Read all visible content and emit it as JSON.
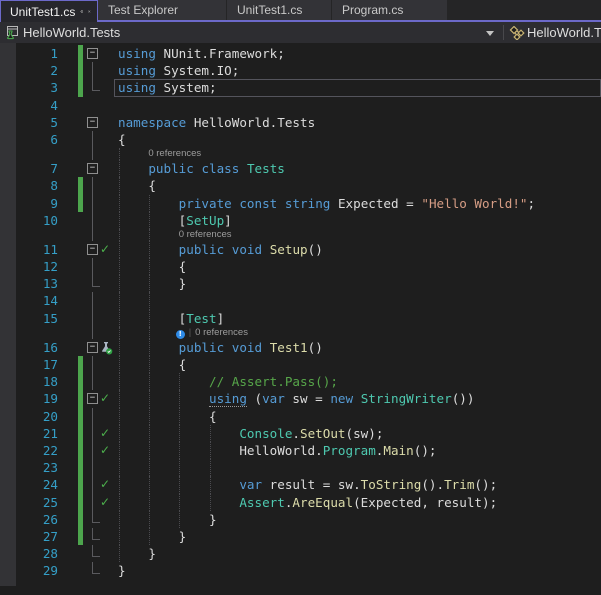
{
  "colors": {
    "accent": "#6C69C9",
    "editor_bg": "#1E1E1E",
    "tabwell_bg": "#252526",
    "tab_inactive_bg": "#333337",
    "navbar_bg": "#2D2D31",
    "margin_bg": "#333336",
    "keyword": "#569CD6",
    "type": "#4EC9B0",
    "method": "#DCDCAA",
    "string_lit": "#D69D85",
    "comment": "#57A64A",
    "plain": "#DCDCDC",
    "lineno": "#359FC7",
    "codelens": "#9D9D9D",
    "change_bar": "#4DA54D",
    "check": "#4CB04C",
    "guide": "#4B4B4F",
    "fold": "#5A5A5E",
    "current_line_border": "#54545C",
    "lens_info": "#2E8AE6"
  },
  "tabs": {
    "active": "UnitTest1.cs",
    "inactive": [
      "Test Explorer",
      "UnitTest1.cs",
      "Program.cs"
    ]
  },
  "navbar": {
    "project": "HelloWorld.Tests",
    "type_label": "HelloWorld.Tests"
  },
  "icons": {
    "fold_collapse": "−",
    "check": "✓",
    "lens_info_glyph": "!"
  },
  "editor": {
    "codelens_text": "0 references",
    "lines": [
      {
        "t": "c",
        "n": 1,
        "bar": 1,
        "fold": "box",
        "g": [],
        "tok": [
          [
            "k",
            "using"
          ],
          [
            "p",
            " NUnit.Framework;"
          ]
        ]
      },
      {
        "t": "c",
        "n": 2,
        "bar": 1,
        "fold": "line",
        "g": [],
        "tok": [
          [
            "k",
            "using"
          ],
          [
            "p",
            " System.IO;"
          ]
        ]
      },
      {
        "t": "c",
        "n": 3,
        "bar": 1,
        "cur": 1,
        "fold": "end",
        "g": [],
        "tok": [
          [
            "k",
            "using"
          ],
          [
            "p",
            " System;"
          ]
        ]
      },
      {
        "t": "c",
        "n": 4,
        "fold": "",
        "g": [],
        "tok": []
      },
      {
        "t": "c",
        "n": 5,
        "fold": "box",
        "g": [],
        "tok": [
          [
            "k",
            "namespace"
          ],
          [
            "p",
            " HelloWorld.Tests"
          ]
        ]
      },
      {
        "t": "c",
        "n": 6,
        "fold": "line",
        "g": [],
        "tok": [
          [
            "p",
            "{"
          ]
        ]
      },
      {
        "t": "l",
        "text": "0 references",
        "ind": 4,
        "fold": "line",
        "g": [
          0
        ]
      },
      {
        "t": "c",
        "n": 7,
        "fold": "box",
        "g": [
          0
        ],
        "tok": [
          [
            "p",
            "    "
          ],
          [
            "k",
            "public"
          ],
          [
            "p",
            " "
          ],
          [
            "k",
            "class"
          ],
          [
            "p",
            " "
          ],
          [
            "ty",
            "Tests"
          ]
        ]
      },
      {
        "t": "c",
        "n": 8,
        "bar": 1,
        "fold": "line",
        "g": [
          0
        ],
        "tok": [
          [
            "p",
            "    {"
          ]
        ]
      },
      {
        "t": "c",
        "n": 9,
        "bar": 1,
        "fold": "line",
        "g": [
          0,
          4
        ],
        "tok": [
          [
            "p",
            "        "
          ],
          [
            "k",
            "private"
          ],
          [
            "p",
            " "
          ],
          [
            "k",
            "const"
          ],
          [
            "p",
            " "
          ],
          [
            "k",
            "string"
          ],
          [
            "p",
            " Expected = "
          ],
          [
            "s",
            "\"Hello World!\""
          ],
          [
            "p",
            ";"
          ]
        ]
      },
      {
        "t": "c",
        "n": 10,
        "fold": "line",
        "g": [
          0,
          4
        ],
        "tok": [
          [
            "p",
            "        ["
          ],
          [
            "ty",
            "SetUp"
          ],
          [
            "p",
            "]"
          ]
        ]
      },
      {
        "t": "l",
        "text": "0 references",
        "ind": 8,
        "fold": "line",
        "g": [
          0,
          4
        ]
      },
      {
        "t": "c",
        "n": 11,
        "fold": "box",
        "glyph": "check",
        "g": [
          0,
          4
        ],
        "tok": [
          [
            "p",
            "        "
          ],
          [
            "k",
            "public"
          ],
          [
            "p",
            " "
          ],
          [
            "k",
            "void"
          ],
          [
            "p",
            " "
          ],
          [
            "m",
            "Setup"
          ],
          [
            "p",
            "()"
          ]
        ]
      },
      {
        "t": "c",
        "n": 12,
        "fold": "line",
        "g": [
          0,
          4
        ],
        "tok": [
          [
            "p",
            "        {"
          ]
        ]
      },
      {
        "t": "c",
        "n": 13,
        "fold": "end",
        "g": [
          0,
          4
        ],
        "tok": [
          [
            "p",
            "        }"
          ]
        ]
      },
      {
        "t": "c",
        "n": 14,
        "fold": "line",
        "g": [
          0,
          4
        ],
        "tok": []
      },
      {
        "t": "c",
        "n": 15,
        "fold": "line",
        "g": [
          0,
          4
        ],
        "tok": [
          [
            "p",
            "        ["
          ],
          [
            "ty",
            "Test"
          ],
          [
            "p",
            "]"
          ]
        ]
      },
      {
        "t": "l",
        "text": "0 references",
        "ind": 8,
        "fold": "line",
        "g": [
          0,
          4
        ],
        "info": 1
      },
      {
        "t": "c",
        "n": 16,
        "fold": "box",
        "glyph": "flask",
        "g": [
          0,
          4
        ],
        "tok": [
          [
            "p",
            "        "
          ],
          [
            "k",
            "public"
          ],
          [
            "p",
            " "
          ],
          [
            "k",
            "void"
          ],
          [
            "p",
            " "
          ],
          [
            "m",
            "Test1"
          ],
          [
            "p",
            "()"
          ]
        ]
      },
      {
        "t": "c",
        "n": 17,
        "bar": 1,
        "fold": "line",
        "g": [
          0,
          4
        ],
        "tok": [
          [
            "p",
            "        {"
          ]
        ]
      },
      {
        "t": "c",
        "n": 18,
        "bar": 1,
        "fold": "line",
        "g": [
          0,
          4,
          8
        ],
        "tok": [
          [
            "p",
            "            "
          ],
          [
            "c",
            "// Assert.Pass();"
          ]
        ]
      },
      {
        "t": "c",
        "n": 19,
        "bar": 1,
        "fold": "box",
        "glyph": "check",
        "g": [
          0,
          4,
          8
        ],
        "tok": [
          [
            "p",
            "            "
          ],
          [
            "ku",
            "using"
          ],
          [
            "p",
            " ("
          ],
          [
            "k",
            "var"
          ],
          [
            "p",
            " sw = "
          ],
          [
            "k",
            "new"
          ],
          [
            "p",
            " "
          ],
          [
            "ty",
            "StringWriter"
          ],
          [
            "p",
            "())"
          ]
        ]
      },
      {
        "t": "c",
        "n": 20,
        "bar": 1,
        "fold": "line",
        "g": [
          0,
          4,
          8
        ],
        "tok": [
          [
            "p",
            "            {"
          ]
        ]
      },
      {
        "t": "c",
        "n": 21,
        "bar": 1,
        "fold": "line",
        "glyph": "check",
        "g": [
          0,
          4,
          8,
          12
        ],
        "tok": [
          [
            "p",
            "                "
          ],
          [
            "ty",
            "Console"
          ],
          [
            "p",
            "."
          ],
          [
            "m",
            "SetOut"
          ],
          [
            "p",
            "(sw);"
          ]
        ]
      },
      {
        "t": "c",
        "n": 22,
        "bar": 1,
        "fold": "line",
        "glyph": "check",
        "g": [
          0,
          4,
          8,
          12
        ],
        "tok": [
          [
            "p",
            "                HelloWorld."
          ],
          [
            "ty",
            "Program"
          ],
          [
            "p",
            "."
          ],
          [
            "m",
            "Main"
          ],
          [
            "p",
            "();"
          ]
        ]
      },
      {
        "t": "c",
        "n": 23,
        "bar": 1,
        "fold": "line",
        "g": [
          0,
          4,
          8,
          12
        ],
        "tok": []
      },
      {
        "t": "c",
        "n": 24,
        "bar": 1,
        "fold": "line",
        "glyph": "check",
        "g": [
          0,
          4,
          8,
          12
        ],
        "tok": [
          [
            "p",
            "                "
          ],
          [
            "k",
            "var"
          ],
          [
            "p",
            " result = sw."
          ],
          [
            "m",
            "ToString"
          ],
          [
            "p",
            "()."
          ],
          [
            "m",
            "Trim"
          ],
          [
            "p",
            "();"
          ]
        ]
      },
      {
        "t": "c",
        "n": 25,
        "bar": 1,
        "fold": "line",
        "glyph": "check",
        "g": [
          0,
          4,
          8,
          12
        ],
        "tok": [
          [
            "p",
            "                "
          ],
          [
            "ty",
            "Assert"
          ],
          [
            "p",
            "."
          ],
          [
            "m",
            "AreEqual"
          ],
          [
            "p",
            "(Expected, result);"
          ]
        ]
      },
      {
        "t": "c",
        "n": 26,
        "bar": 1,
        "fold": "end",
        "g": [
          0,
          4,
          8
        ],
        "tok": [
          [
            "p",
            "            }"
          ]
        ]
      },
      {
        "t": "c",
        "n": 27,
        "bar": 1,
        "fold": "end",
        "g": [
          0,
          4
        ],
        "tok": [
          [
            "p",
            "        }"
          ]
        ]
      },
      {
        "t": "c",
        "n": 28,
        "fold": "end",
        "g": [
          0
        ],
        "tok": [
          [
            "p",
            "    }"
          ]
        ]
      },
      {
        "t": "c",
        "n": 29,
        "fold": "end",
        "g": [],
        "tok": [
          [
            "p",
            "}"
          ]
        ]
      }
    ]
  }
}
